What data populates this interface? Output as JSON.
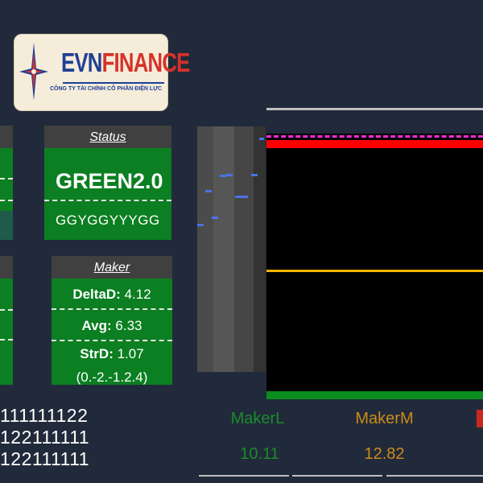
{
  "logo": {
    "brand_evn": "EVN",
    "brand_finance": "FINANCE",
    "tagline": "CÔNG TY TÀI CHÍNH CỔ PHẦN ĐIỆN LỰC",
    "colors": {
      "blue": "#1e3f97",
      "red": "#d6322b"
    }
  },
  "status": {
    "title": "Status",
    "value": "GREEN2.0",
    "sequence": "GGYGGYYYGG"
  },
  "maker": {
    "title": "Maker",
    "delta_label": "DeltaD:",
    "delta_value": "4.12",
    "avg_label": "Avg:",
    "avg_value": "6.33",
    "strd_label": "StrD:",
    "strd_value": "1.07",
    "pattern": "(0.-2.-1.2.4)"
  },
  "numbers": {
    "line1": "111111122",
    "line2": "122111111",
    "line3": "122111111"
  },
  "legend": {
    "maker_l": "MakerL",
    "maker_m": "MakerM",
    "maker_l_value": "10.11",
    "maker_m_value": "12.82"
  },
  "colors": {
    "background": "#212a3a",
    "panel_green": "#0b7f21",
    "panel_header": "#404040",
    "maker_l": "#1a8c2a",
    "maker_m": "#cc8a1a",
    "line_red": "#ff0000",
    "line_yellow": "#ffb300",
    "line_magenta": "#ff2bd6",
    "marker_blue": "#4b72e6"
  }
}
